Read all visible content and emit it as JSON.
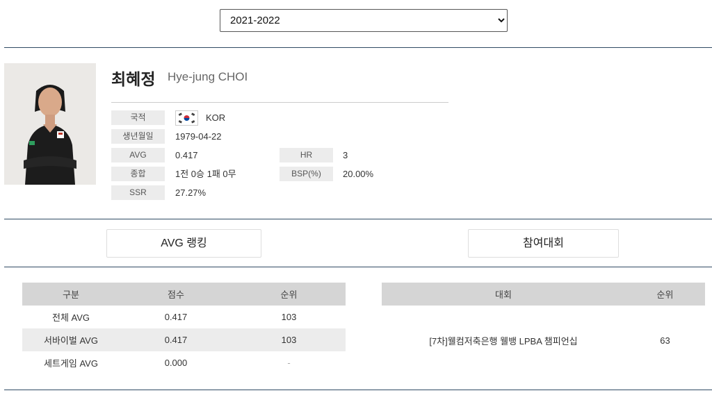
{
  "season": {
    "selected": "2021-2022"
  },
  "player": {
    "name_ko": "최혜정",
    "name_en": "Hye-jung CHOI",
    "fields": {
      "nationality": {
        "label": "국적",
        "value": "KOR"
      },
      "birth": {
        "label": "생년월일",
        "value": "1979-04-22"
      },
      "avg": {
        "label": "AVG",
        "value": "0.417"
      },
      "record": {
        "label": "종합",
        "value": "1전 0승 1패 0무"
      },
      "ssr": {
        "label": "SSR",
        "value": "27.27%"
      },
      "hr": {
        "label": "HR",
        "value": "3"
      },
      "bsp": {
        "label": "BSP(%)",
        "value": "20.00%"
      }
    }
  },
  "tabs": {
    "ranking": "AVG 랭킹",
    "tournaments": "참여대회"
  },
  "ranking_table": {
    "headers": [
      "구분",
      "점수",
      "순위"
    ],
    "rows": [
      [
        "전체 AVG",
        "0.417",
        "103"
      ],
      [
        "서바이벌 AVG",
        "0.417",
        "103"
      ],
      [
        "세트게임 AVG",
        "0.000",
        "-"
      ]
    ]
  },
  "tournament_table": {
    "headers": [
      "대회",
      "순위"
    ],
    "rows": [
      [
        "[7차]웰컴저축은행 웰뱅 LPBA 챔피언십",
        "63"
      ]
    ]
  },
  "colors": {
    "divider": "#2f4a63",
    "label_bg": "#ececec",
    "header_bg": "#d5d5d5"
  }
}
